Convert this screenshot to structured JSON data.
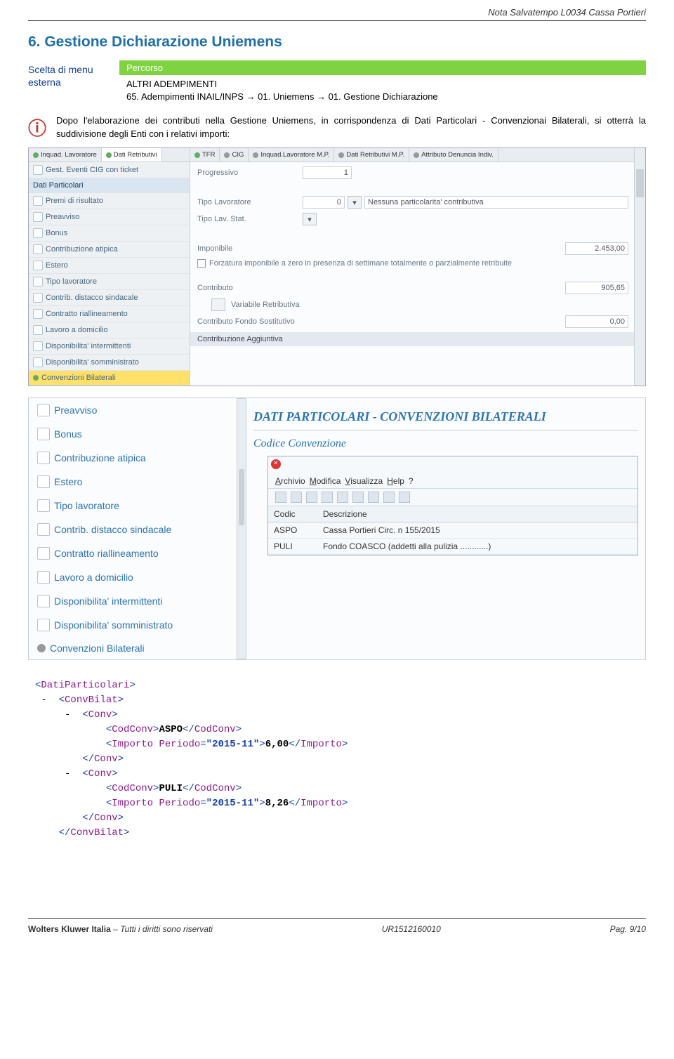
{
  "doc_header": "Nota Salvatempo  L0034 Cassa Portieri",
  "section_title": "6.  Gestione  Dichiarazione Uniemens",
  "menu_ext_line1": "Scelta di menu",
  "menu_ext_line2": "esterna",
  "percorso_label": "Percorso",
  "percorso_line1": "ALTRI ADEMPIMENTI",
  "percorso_line2": "65. Adempimenti INAIL/INPS → 01. Uniemens → 01. Gestione Dichiarazione",
  "info_text": "Dopo l'elaborazione dei contributi nella Gestione Uniemens, in corrispondenza di Dati Particolari - Convenzionai Bilaterali, si otterrà la suddivisione degli Enti con i relativi importi:",
  "tabs": {
    "t0": "Inquad. Lavoratore",
    "t1": "Dati Retributivi",
    "t2": "TFR",
    "t3": "CIG",
    "t4": "Inquad.Lavoratore M.P.",
    "t5": "Dati Retributivi M.P.",
    "t6": "Attributo Denuncia Indiv."
  },
  "side1": {
    "a": "Gest. Eventi CIG con ticket",
    "b": "Dati Particolari",
    "c": "Premi di risultato",
    "d": "Preavviso",
    "e": "Bonus",
    "f": "Contribuzione atipica",
    "g": "Estero",
    "h": "Tipo lavoratore",
    "i": "Contrib. distacco sindacale",
    "j": "Contratto riallineamento",
    "k": "Lavoro a domicilio",
    "l": "Disponibilita' intermittenti",
    "m": "Disponibilita' somministrato",
    "n": "Convenzioni Bilaterali"
  },
  "form1": {
    "progressivo_lbl": "Progressivo",
    "progressivo_val": "1",
    "tipo_lav_lbl": "Tipo Lavoratore",
    "tipo_lav_val": "0",
    "tipo_lav_desc": "Nessuna particolarita' contributiva",
    "tipo_lav_stat_lbl": "Tipo Lav. Stat.",
    "imponibile_lbl": "Imponibile",
    "imponibile_val": "2.453,00",
    "forzatura_lbl": "Forzatura imponibile a zero in presenza di settimane totalmente o parzialmente retribuite",
    "contributo_lbl": "Contributo",
    "contributo_val": "905,65",
    "var_retr_lbl": "Variabile Retributiva",
    "fondo_sost_lbl": "Contributo Fondo Sostitutivo",
    "fondo_sost_val": "0,00",
    "contr_agg_lbl": "Contribuzione Aggiuntiva"
  },
  "side2": {
    "a": "Preavviso",
    "b": "Bonus",
    "c": "Contribuzione atipica",
    "d": "Estero",
    "e": "Tipo lavoratore",
    "f": "Contrib. distacco sindacale",
    "g": "Contratto riallineamento",
    "h": "Lavoro a domicilio",
    "i": "Disponibilita' intermittenti",
    "j": "Disponibilita' somministrato",
    "k": "Convenzioni Bilaterali"
  },
  "panel2": {
    "title": "DATI PARTICOLARI - CONVENZIONI BILATERALI",
    "subtitle": "Codice Convenzione"
  },
  "popup": {
    "m1": "Archivio",
    "m2": "Modifica",
    "m3": "Visualizza",
    "m4": "Help",
    "m5": "?",
    "col1": "Codic",
    "col2": "Descrizione",
    "r1c1": "ASPO",
    "r1c2": "Cassa Portieri Circ. n 155/2015",
    "r2c1": "PULI",
    "r2c2": "Fondo COASCO (addetti alla pulizia ............)"
  },
  "xml": {
    "dp_open": "<DatiParticolari>",
    "cb_open": "<ConvBilat>",
    "cv_open": "<Conv>",
    "cc_open": "<CodConv>",
    "cc_close": "</CodConv>",
    "cc1_val": "ASPO",
    "imp_open_pre": "<Importo Periodo=",
    "imp_attr1": "\"2015-11\"",
    "imp_open_post": ">",
    "imp1_val": "6,00",
    "imp_close": "</Importo>",
    "cv_close": "</Conv>",
    "cc2_val": "PULI",
    "imp2_val": "8,26",
    "cb_close": "</ConvBilat>"
  },
  "footer": {
    "company": "Wolters Kluwer Italia",
    "rights": " – Tutti i diritti sono riservati",
    "code": "UR1512160010",
    "page": "Pag.  9/10"
  }
}
